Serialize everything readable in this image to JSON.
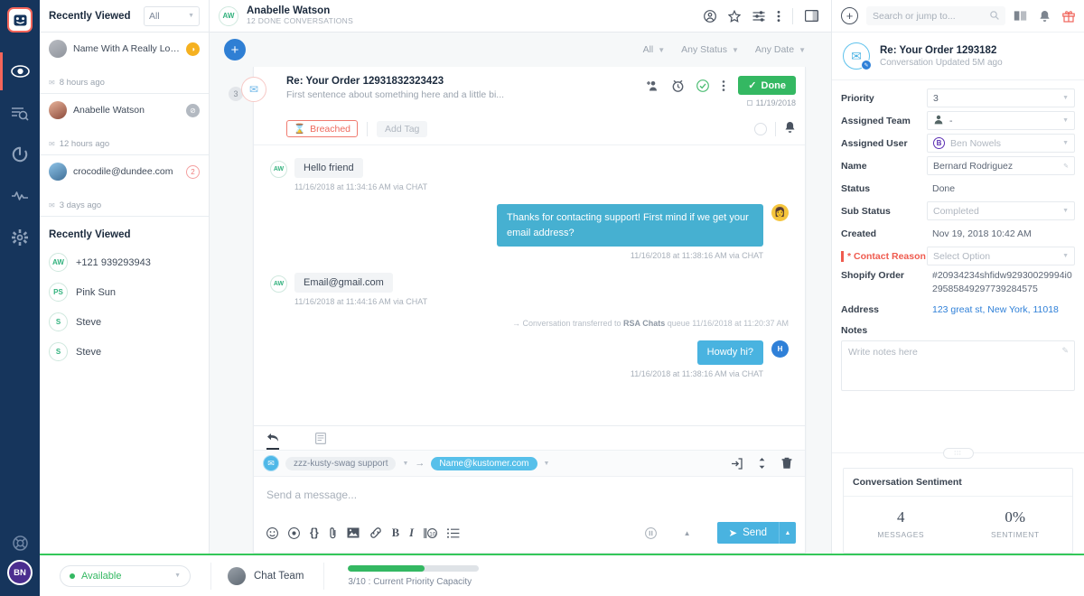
{
  "nav": {
    "logo_icon": "kustomer-face-logo",
    "items": [
      {
        "name": "eye-icon",
        "label": "Views",
        "active": true
      },
      {
        "name": "search-list-icon",
        "label": "Search",
        "active": false
      },
      {
        "name": "refresh-icon",
        "label": "Refresh",
        "active": false
      },
      {
        "name": "pulse-icon",
        "label": "Activity",
        "active": false
      },
      {
        "name": "gear-icon",
        "label": "Settings",
        "active": false
      }
    ],
    "help_icon": "lifebuoy-icon",
    "avatar_initials": "BN"
  },
  "recent_panel": {
    "title": "Recently Viewed",
    "filter_value": "All",
    "cards": [
      {
        "name": "Name With A Really Lon...",
        "time": "8 hours ago",
        "badge": "◑",
        "badge_style": "amber",
        "avatar_style": "g1"
      },
      {
        "name": "Anabelle Watson",
        "time": "12 hours ago",
        "badge": "⊘",
        "badge_style": "grey",
        "avatar_style": "g2"
      },
      {
        "name": "crocodile@dundee.com",
        "time": "3 days ago",
        "badge": "2",
        "badge_style": "red",
        "avatar_style": "g3"
      }
    ],
    "sub_title": "Recently Viewed",
    "sub_items": [
      {
        "initials": "AW",
        "label": "+121 939293943"
      },
      {
        "initials": "PS",
        "label": "Pink Sun"
      },
      {
        "initials": "S",
        "label": "Steve"
      },
      {
        "initials": "S",
        "label": "Steve"
      }
    ]
  },
  "main_header": {
    "avatar_initials": "AW",
    "title": "Anabelle Watson",
    "subtitle": "12 DONE CONVERSATIONS",
    "icons": [
      {
        "name": "user-circle-icon",
        "glyph": "◎"
      },
      {
        "name": "star-icon",
        "glyph": "☆"
      },
      {
        "name": "filter-sliders-icon",
        "glyph": "☰"
      },
      {
        "name": "more-vertical-icon",
        "glyph": "⋮"
      },
      {
        "name": "panel-toggle-icon",
        "glyph": "▤"
      }
    ]
  },
  "filter_row": {
    "add_label": "+",
    "filters": [
      {
        "name": "filter-all",
        "label": "All"
      },
      {
        "name": "filter-status",
        "label": "Any Status"
      },
      {
        "name": "filter-date",
        "label": "Any Date"
      }
    ]
  },
  "thread": {
    "gutter_count": "3",
    "envelope_icon": "envelope-icon",
    "title": "Re: Your Order 12931832323423",
    "snippet": "First sentence about something here and a little bi...",
    "icons": [
      {
        "name": "add-participant-icon",
        "glyph": "⊕"
      },
      {
        "name": "snooze-clock-icon",
        "glyph": "⏱"
      },
      {
        "name": "check-circle-icon",
        "glyph": "✔"
      },
      {
        "name": "more-vertical-icon",
        "glyph": "⋮"
      }
    ],
    "done_label": "Done",
    "done_date": "11/19/2018",
    "breached_label": "Breached",
    "add_tag_label": "Add Tag",
    "messages": [
      {
        "dir": "in",
        "avatar": "AW",
        "text": "Hello friend",
        "time": "11/16/2018 at 11:34:16 AM via CHAT"
      },
      {
        "dir": "out",
        "avatar": "👩",
        "avatar_kind": "emoji",
        "text": "Thanks for contacting support! First mind if we get your email address?",
        "time": "11/16/2018 at 11:38:16 AM via CHAT",
        "size": "long"
      },
      {
        "dir": "in",
        "avatar": "AW",
        "text": "Email@gmail.com",
        "time": "11/16/2018 at 11:44:16 AM via CHAT"
      }
    ],
    "system_note_prefix": "→ Conversation transferred to ",
    "system_note_queue": "RSA Chats",
    "system_note_suffix": " queue 11/16/2018 at 11:20:37 AM",
    "last_message": {
      "dir": "out",
      "avatar": "H",
      "avatar_kind": "letter",
      "text": "Howdy hi?",
      "time": "11/16/2018 at 11:38:16 AM via CHAT"
    }
  },
  "composer": {
    "tabs": [
      {
        "name": "reply-tab",
        "glyph": "↩",
        "active": true
      },
      {
        "name": "note-tab",
        "glyph": "▤",
        "active": false
      }
    ],
    "from_chip": "zzz-kusty-swag support",
    "arrow": "→",
    "to_chip": "Name@kustomer.com",
    "right_icons": [
      {
        "name": "signature-insert-icon",
        "glyph": "⮊"
      },
      {
        "name": "expand-collapse-icon",
        "glyph": "↕"
      },
      {
        "name": "trash-icon",
        "glyph": "🗑"
      }
    ],
    "placeholder": "Send a message...",
    "toolbar_icons": [
      {
        "name": "emoji-icon",
        "glyph": "☺"
      },
      {
        "name": "snippet-icon",
        "glyph": "⊙"
      },
      {
        "name": "code-icon",
        "glyph": "{}"
      },
      {
        "name": "attachment-icon",
        "glyph": "📎"
      },
      {
        "name": "image-icon",
        "glyph": "▣"
      },
      {
        "name": "link-icon",
        "glyph": "🔗"
      },
      {
        "name": "bold-icon",
        "glyph": "B"
      },
      {
        "name": "italic-icon",
        "glyph": "I"
      },
      {
        "name": "shortcut-icon",
        "glyph": "⌨"
      },
      {
        "name": "list-icon",
        "glyph": "≡"
      }
    ],
    "pause_icon": "ⓣ",
    "caret_icon": "▲",
    "send_label": "Send",
    "send_arrow": "➤"
  },
  "right_panel": {
    "top": {
      "plus": "+",
      "search_placeholder": "Search or jump to...",
      "search_icon": "search-icon",
      "icons": [
        {
          "name": "knowledge-book-icon",
          "glyph": "📖"
        },
        {
          "name": "bell-icon",
          "glyph": "🔔"
        },
        {
          "name": "gift-icon",
          "glyph": "🎁"
        }
      ]
    },
    "conversation": {
      "icon": "envelope-icon",
      "edit_badge": "edit-pencil-icon",
      "title": "Re: Your Order 1293182",
      "subtitle": "Conversation Updated 5M ago"
    },
    "fields": [
      {
        "label": "Priority",
        "value": "3",
        "kind": "select"
      },
      {
        "label": "Assigned Team",
        "value": "-",
        "kind": "select",
        "icon": "👥"
      },
      {
        "label": "Assigned User",
        "value": "Ben Nowels",
        "kind": "select-user",
        "initial": "B",
        "muted": true
      },
      {
        "label": "Name",
        "value": "Bernard Rodriguez",
        "kind": "input-edit"
      },
      {
        "label": "Status",
        "value": "Done",
        "kind": "plain"
      },
      {
        "label": "Sub Status",
        "value": "Completed",
        "kind": "select",
        "muted": true
      },
      {
        "label": "Created",
        "value": "Nov 19, 2018 10:42 AM",
        "kind": "plain"
      },
      {
        "label": "* Contact Reason",
        "value": "Select Option",
        "kind": "select",
        "muted": true,
        "required": true
      },
      {
        "label": "Shopify Order",
        "value": "#20934234shfidw92930029994i029585849297739284575",
        "kind": "multiline"
      },
      {
        "label": "Address",
        "value": "123 great st, New York, 11018",
        "kind": "link"
      }
    ],
    "notes": {
      "label": "Notes",
      "placeholder": "Write notes here",
      "edit_icon": "pencil-icon"
    },
    "drag_handle": "∶∶∶",
    "sentiment": {
      "title": "Conversation Sentiment",
      "messages_value": "4",
      "messages_caption": "MESSAGES",
      "sentiment_value": "0%",
      "sentiment_caption": "SENTIMENT"
    }
  },
  "bottom_bar": {
    "status": "Available",
    "team_label": "Chat Team",
    "capacity_text": "3/10 : Current Priority Capacity",
    "capacity_percent": 58,
    "accent_green": "#34c759"
  }
}
